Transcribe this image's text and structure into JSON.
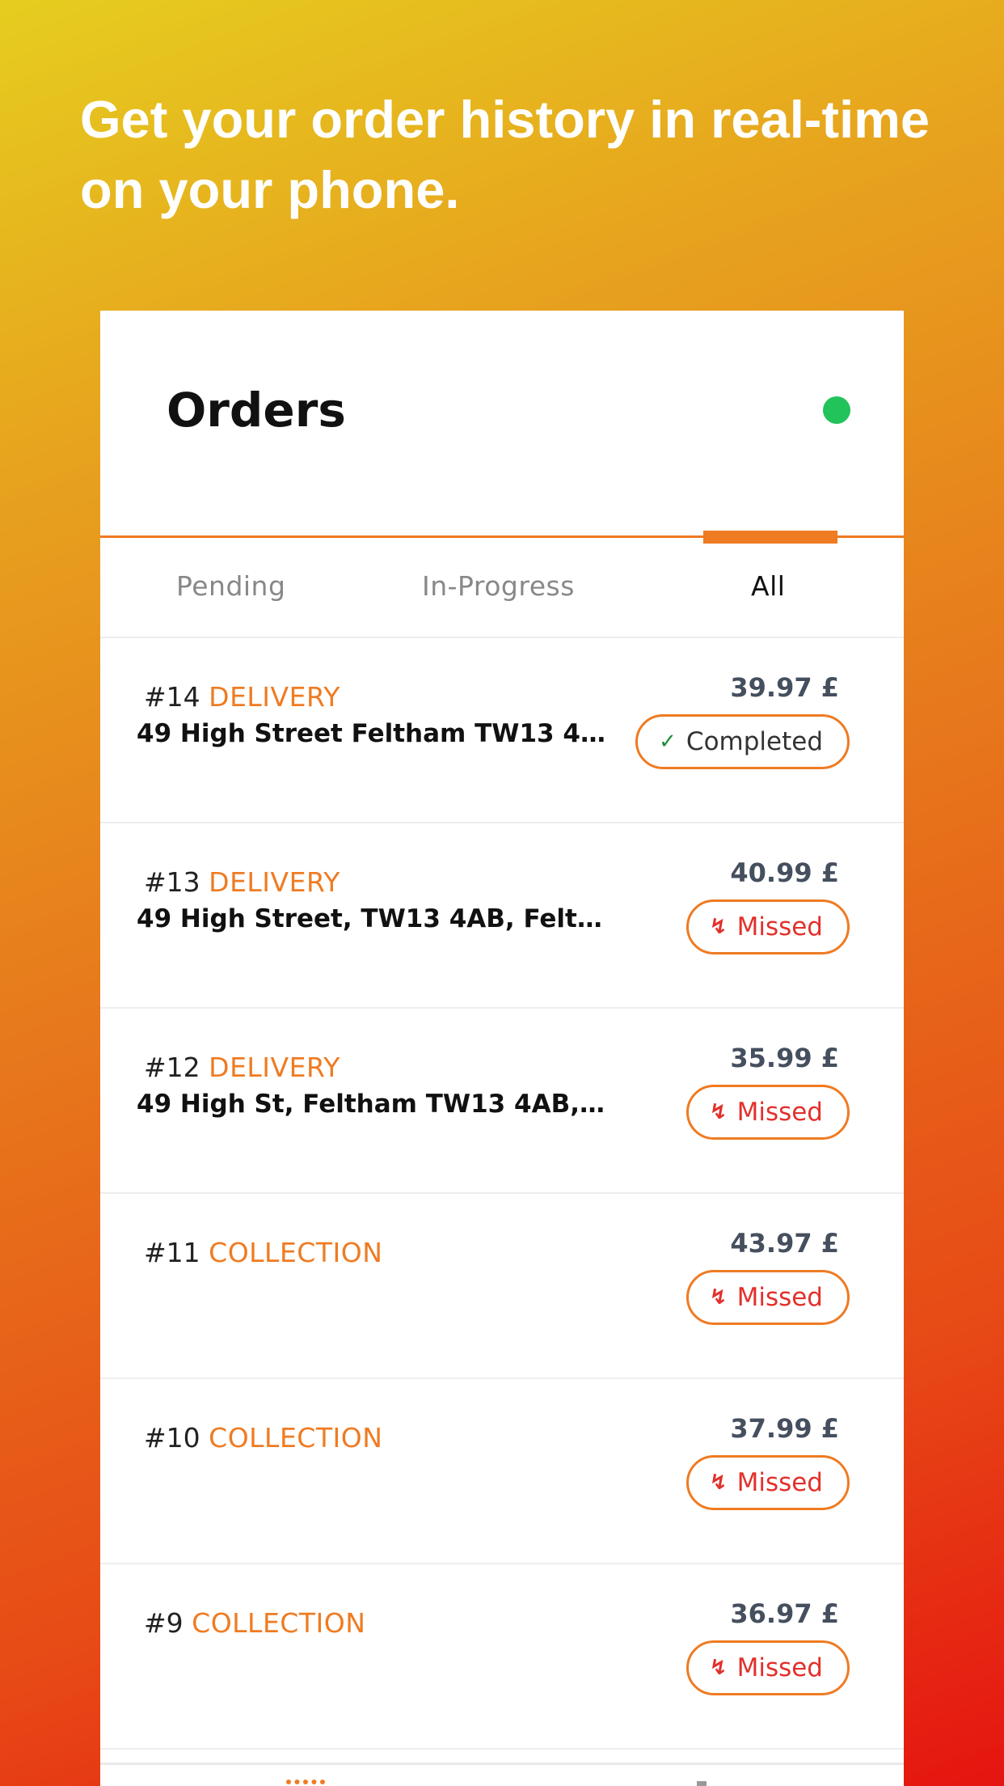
{
  "promo": {
    "headline": "Get your order history in real-time on your phone."
  },
  "header": {
    "title": "Orders",
    "status_color": "#22c35a"
  },
  "tabs": [
    {
      "label": "Pending",
      "active": false
    },
    {
      "label": "In-Progress",
      "active": false
    },
    {
      "label": "All",
      "active": true
    }
  ],
  "orders": [
    {
      "number": "#14",
      "type": "DELIVERY",
      "address": "49 High Street Feltham TW13 4...",
      "price": "39.97 £",
      "status": "Completed",
      "status_icon": "check-icon"
    },
    {
      "number": "#13",
      "type": "DELIVERY",
      "address": "49 High Street, TW13 4AB, Felt...",
      "price": "40.99 £",
      "status": "Missed",
      "status_icon": "missed-call-icon"
    },
    {
      "number": "#12",
      "type": "DELIVERY",
      "address": "49 High St, Feltham TW13 4AB,...",
      "price": "35.99 £",
      "status": "Missed",
      "status_icon": "missed-call-icon"
    },
    {
      "number": "#11",
      "type": "COLLECTION",
      "address": "",
      "price": "43.97 £",
      "status": "Missed",
      "status_icon": "missed-call-icon"
    },
    {
      "number": "#10",
      "type": "COLLECTION",
      "address": "",
      "price": "37.99 £",
      "status": "Missed",
      "status_icon": "missed-call-icon"
    },
    {
      "number": "#9",
      "type": "COLLECTION",
      "address": "",
      "price": "36.97 £",
      "status": "Missed",
      "status_icon": "missed-call-icon"
    }
  ],
  "colors": {
    "accent": "#ef7b22",
    "missed": "#e2302b",
    "completed_check": "#1f8a3a"
  }
}
